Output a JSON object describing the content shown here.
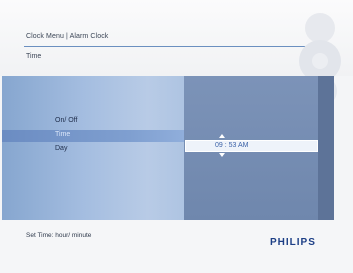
{
  "header": {
    "breadcrumb": "Clock Menu | Alarm Clock",
    "subtitle": "Time"
  },
  "menu": {
    "items": [
      {
        "label": "On/ Off",
        "selected": false
      },
      {
        "label": "Time",
        "selected": true
      },
      {
        "label": "Day",
        "selected": false
      }
    ]
  },
  "time_setting": {
    "value": "09 : 53  AM"
  },
  "footer": {
    "hint": "Set Time: hour/ minute",
    "brand": "PHILIPS"
  },
  "colors": {
    "accent": "#1d3f86",
    "panel_blue": "#a4bde0",
    "selection_blue": "#7f9fd0"
  }
}
